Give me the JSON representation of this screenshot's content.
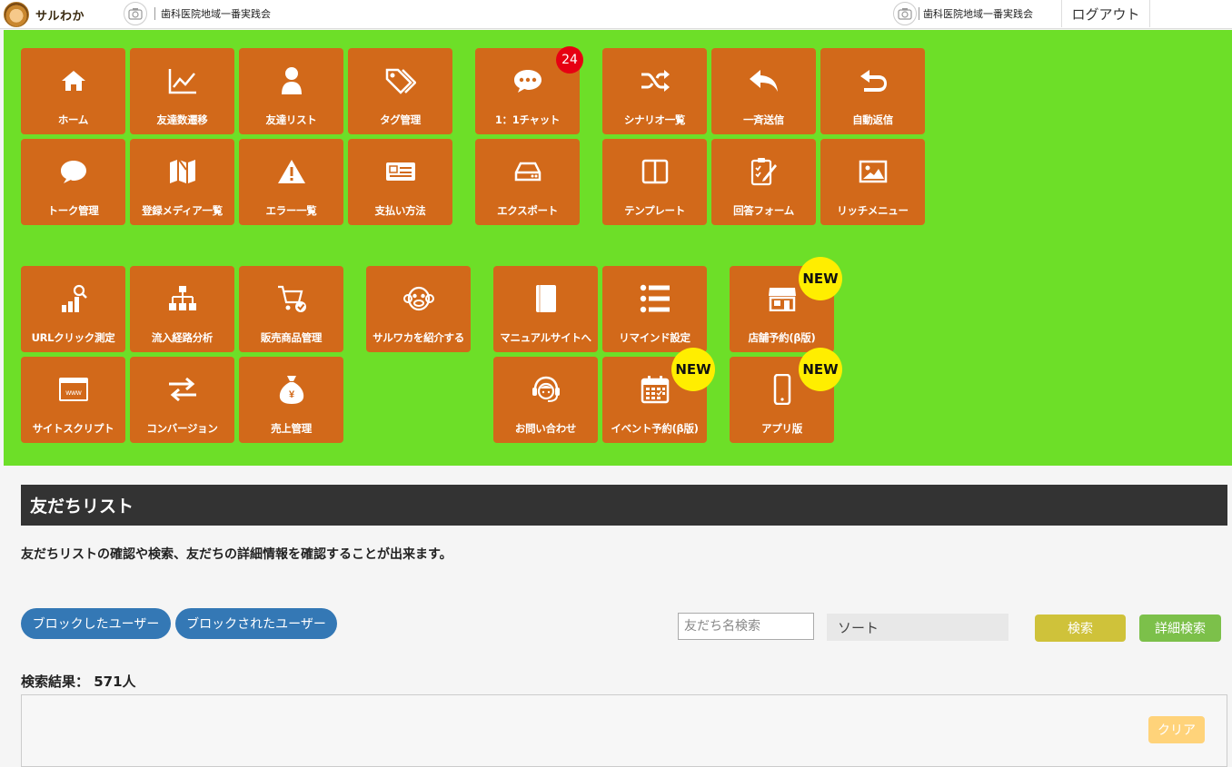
{
  "header": {
    "logo_text": "サルわか",
    "account_left": "歯科医院地域一番実践会",
    "account_right": "歯科医院地域一番実践会",
    "logout_label": "ログアウト"
  },
  "menu": {
    "home": "ホーム",
    "friend_trend": "友達数遷移",
    "friend_list": "友達リスト",
    "tag_manage": "タグ管理",
    "chat": "1：1チャット",
    "chat_badge": "24",
    "scenario": "シナリオ一覧",
    "broadcast": "一斉送信",
    "auto_reply": "自動返信",
    "talk_manage": "トーク管理",
    "media_list": "登録メディア一覧",
    "error_list": "エラー一覧",
    "payment": "支払い方法",
    "export": "エクスポート",
    "template": "テンプレート",
    "answer_form": "回答フォーム",
    "rich_menu": "リッチメニュー",
    "url_click": "URLクリック測定",
    "inflow": "流入経路分析",
    "products": "販売商品管理",
    "introduce": "サルワカを紹介する",
    "manual": "マニュアルサイトへ",
    "remind": "リマインド設定",
    "store_reserve": "店舗予約(β版)",
    "site_script": "サイトスクリプト",
    "conversion": "コンバージョン",
    "sales": "売上管理",
    "contact": "お問い合わせ",
    "event_reserve": "イベント予約(β版)",
    "app": "アプリ版",
    "new_label": "NEW"
  },
  "page": {
    "title": "友だちリスト",
    "description": "友だちリストの確認や検索、友だちの詳細情報を確認することが出来ます。",
    "blocked_btn": "ブロックしたユーザー",
    "blocked_by_btn": "ブロックされたユーザー",
    "search_placeholder": "友だち名検索",
    "sort_label": "ソート",
    "search_btn": "検索",
    "advanced_btn": "詳細検索",
    "result_label": "検索結果： 571人",
    "clear_btn": "クリア"
  },
  "colors": {
    "panel_green": "#6ddf28",
    "tile_orange": "#d2691a",
    "pill_blue": "#3478b5",
    "search_yellow": "#cfc23a",
    "advanced_green": "#7cc04a"
  }
}
